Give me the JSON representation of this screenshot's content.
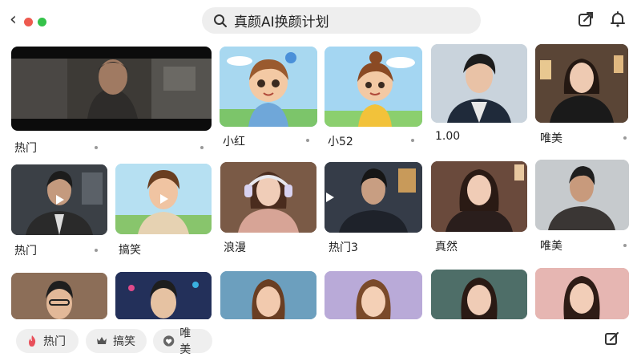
{
  "search": {
    "query": "真颜AI换颜计划"
  },
  "colors": {
    "close": "#ee5a4f",
    "maximize": "#35c24a",
    "accent_pink": "#e8505b"
  },
  "cards": [
    {
      "id": "c1",
      "label": "热门"
    },
    {
      "id": "c2",
      "label": "小红"
    },
    {
      "id": "c3",
      "label": "小52"
    },
    {
      "id": "c4",
      "label": "1.00"
    },
    {
      "id": "c5",
      "label": "唯美"
    },
    {
      "id": "c6",
      "label": "热门"
    },
    {
      "id": "c7",
      "label": "搞笑"
    },
    {
      "id": "c8",
      "label": "浪漫"
    },
    {
      "id": "c9",
      "label": "热门3"
    },
    {
      "id": "c10",
      "label": "真然"
    },
    {
      "id": "c11",
      "label": "唯美"
    }
  ],
  "bottom_tabs": [
    {
      "label": "热门",
      "icon": "flame-icon"
    },
    {
      "label": "搞笑",
      "icon": "crown-icon"
    },
    {
      "label": "唯美",
      "icon": "heart-icon"
    }
  ],
  "icons": [
    "back-icon",
    "search-icon",
    "share-icon",
    "bell-icon",
    "play-icon",
    "edit-icon"
  ]
}
